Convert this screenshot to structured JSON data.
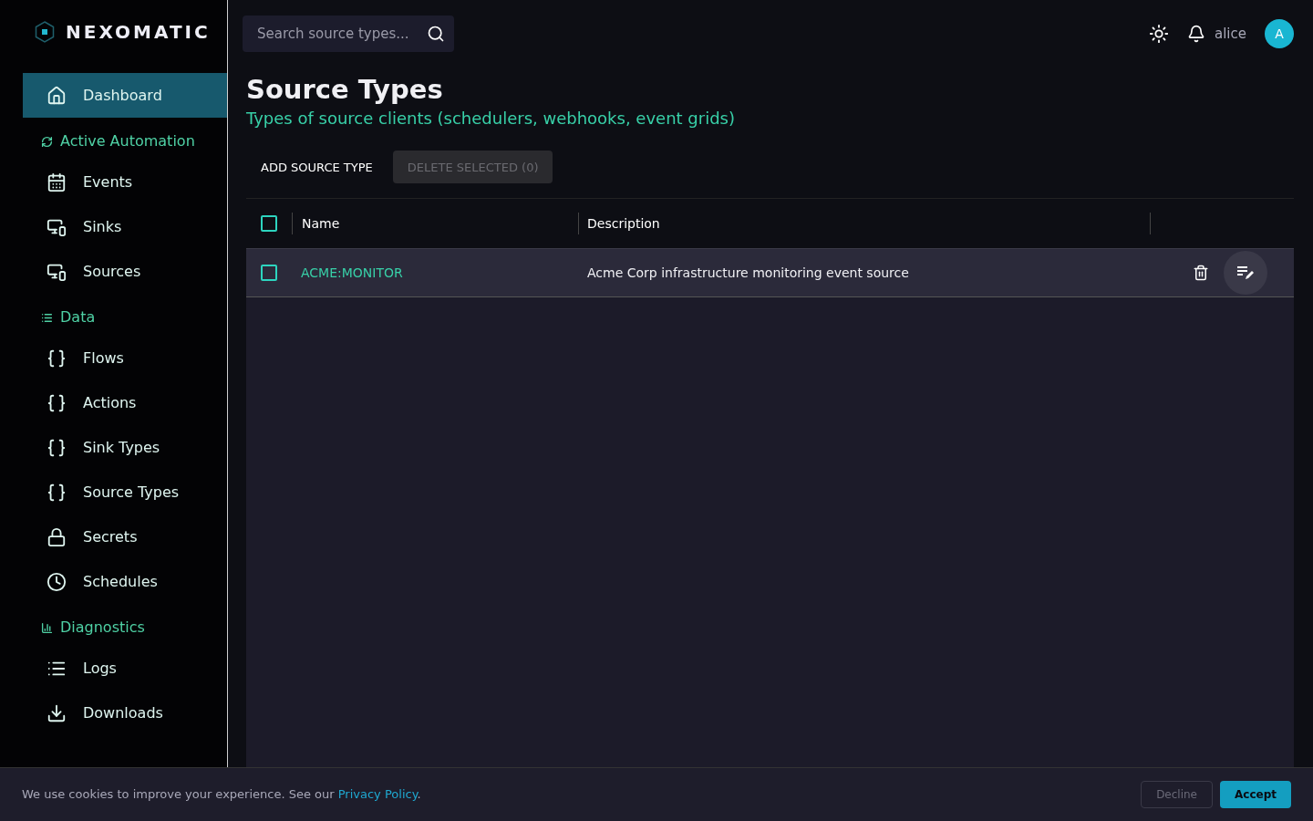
{
  "brand": "NEXOMATIC",
  "sidebar": {
    "items": [
      {
        "kind": "link",
        "label": "Dashboard",
        "selected": true
      },
      {
        "kind": "section",
        "label": "Active Automation"
      },
      {
        "kind": "link",
        "label": "Events",
        "selected": false
      },
      {
        "kind": "link",
        "label": "Sinks",
        "selected": false
      },
      {
        "kind": "link",
        "label": "Sources",
        "selected": false
      },
      {
        "kind": "section",
        "label": "Data"
      },
      {
        "kind": "link",
        "label": "Flows",
        "selected": false
      },
      {
        "kind": "link",
        "label": "Actions",
        "selected": false
      },
      {
        "kind": "link",
        "label": "Sink Types",
        "selected": false
      },
      {
        "kind": "link",
        "label": "Source Types",
        "selected": false
      },
      {
        "kind": "link",
        "label": "Secrets",
        "selected": false
      },
      {
        "kind": "link",
        "label": "Schedules",
        "selected": false
      },
      {
        "kind": "section",
        "label": "Diagnostics"
      },
      {
        "kind": "link",
        "label": "Logs",
        "selected": false
      },
      {
        "kind": "link",
        "label": "Downloads",
        "selected": false
      }
    ]
  },
  "search": {
    "placeholder": "Search source types..."
  },
  "user": {
    "name": "alice",
    "initial": "A"
  },
  "page": {
    "title": "Source Types",
    "subtitle": "Types of source clients (schedulers, webhooks, event grids)"
  },
  "toolbar": {
    "add": {
      "label": "ADD SOURCE TYPE",
      "disabled": false
    },
    "delete": {
      "label": "DELETE SELECTED (0)",
      "disabled": true
    }
  },
  "table": {
    "all_checked": false,
    "columns": [
      "Name",
      "Description"
    ],
    "rows": [
      {
        "name": "ACME:MONITOR",
        "description": "Acme Corp infrastructure monitoring event source",
        "checked": false
      }
    ]
  },
  "cookie": {
    "text": "We use cookies to improve your experience. See our",
    "link": "Privacy Policy",
    "after": ".",
    "decline": "Decline",
    "accept": "Accept"
  }
}
